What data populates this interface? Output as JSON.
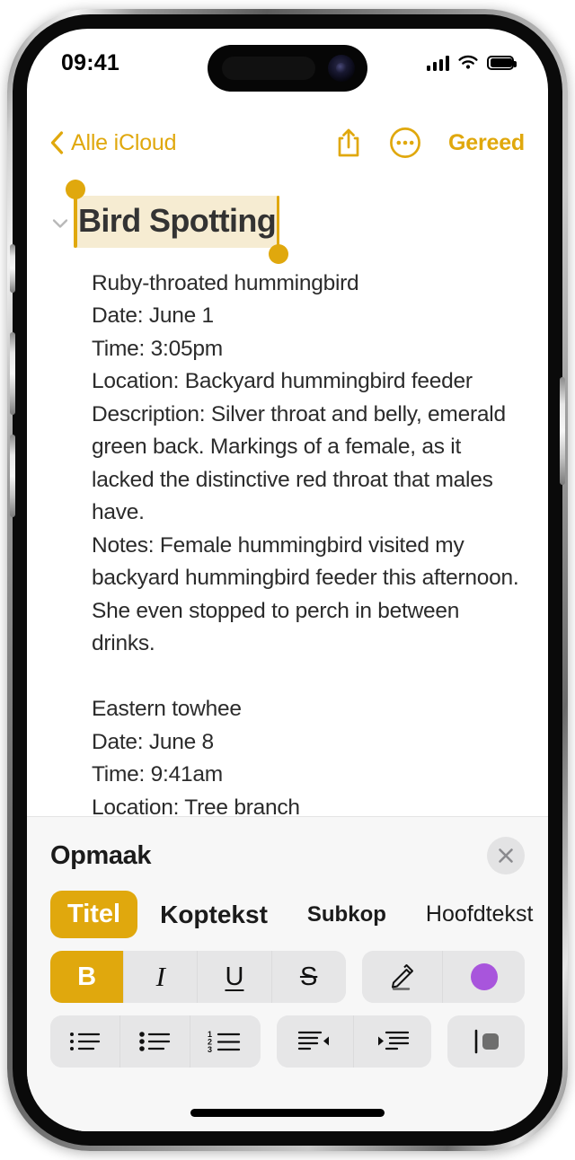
{
  "status_bar": {
    "time": "09:41",
    "signal_icon": "cellular-bars-icon",
    "wifi_icon": "wifi-icon",
    "battery_icon": "battery-full-icon",
    "battery_level": 100
  },
  "nav_bar": {
    "back_label": "Alle iCloud",
    "back_icon": "chevron-left-icon",
    "share_icon": "share-icon",
    "more_icon": "more-circle-icon",
    "done_label": "Gereed"
  },
  "note": {
    "collapse_icon": "chevron-down-icon",
    "title": "Bird Spotting",
    "title_selected": true,
    "selection_highlight_color": "#F6ECD2",
    "body": "Ruby-throated hummingbird\nDate: June 1\nTime: 3:05pm\nLocation: Backyard hummingbird feeder\nDescription: Silver throat and belly, emerald green back. Markings of a female, as it lacked the distinctive red throat that males have.\nNotes: Female hummingbird visited my backyard hummingbird feeder this afternoon. She even stopped to perch in between drinks.\n\nEastern towhee\nDate: June 8\nTime: 9:41am\nLocation: Tree branch"
  },
  "format_panel": {
    "title": "Opmaak",
    "close_icon": "close-icon",
    "styles": [
      {
        "label": "Titel",
        "active": true
      },
      {
        "label": "Koptekst",
        "active": false
      },
      {
        "label": "Subkop",
        "active": false
      },
      {
        "label": "Hoofdtekst",
        "active": false
      }
    ],
    "text_format": [
      {
        "name": "bold-button",
        "glyph": "B",
        "active": true
      },
      {
        "name": "italic-button",
        "glyph": "I",
        "active": false
      },
      {
        "name": "underline-button",
        "glyph": "U",
        "active": false
      },
      {
        "name": "strikethrough-button",
        "glyph": "S",
        "active": false
      }
    ],
    "highlight_icon": "highlighter-pen-icon",
    "highlight_color": "#A855DC",
    "list_buttons": [
      "dashed-list-icon",
      "bulleted-list-icon",
      "numbered-list-icon"
    ],
    "indent_buttons": [
      "outdent-icon",
      "indent-icon"
    ],
    "block_style_icon": "block-quote-icon"
  },
  "colors": {
    "accent": "#E0A80D",
    "panel_background": "#F7F7F7",
    "segment_background": "#E6E6E7",
    "purple": "#A855DC"
  },
  "home_indicator": "home-indicator"
}
